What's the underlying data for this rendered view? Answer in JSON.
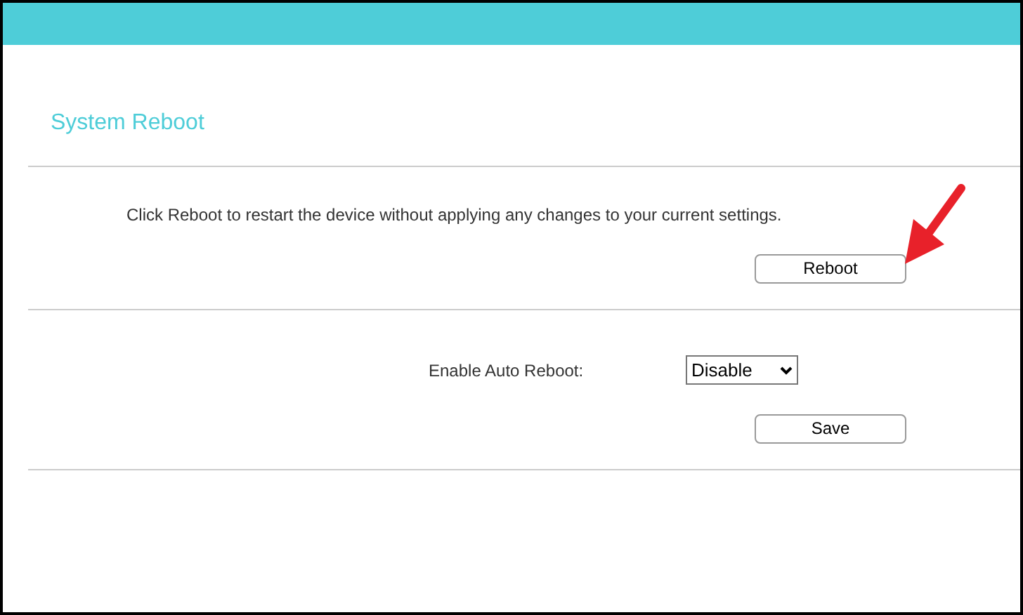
{
  "page": {
    "title": "System Reboot"
  },
  "reboot_section": {
    "description": "Click Reboot to restart the device without applying any changes to your current settings.",
    "button": "Reboot"
  },
  "auto_reboot_section": {
    "label": "Enable Auto Reboot:",
    "value": "Disable",
    "button": "Save"
  }
}
